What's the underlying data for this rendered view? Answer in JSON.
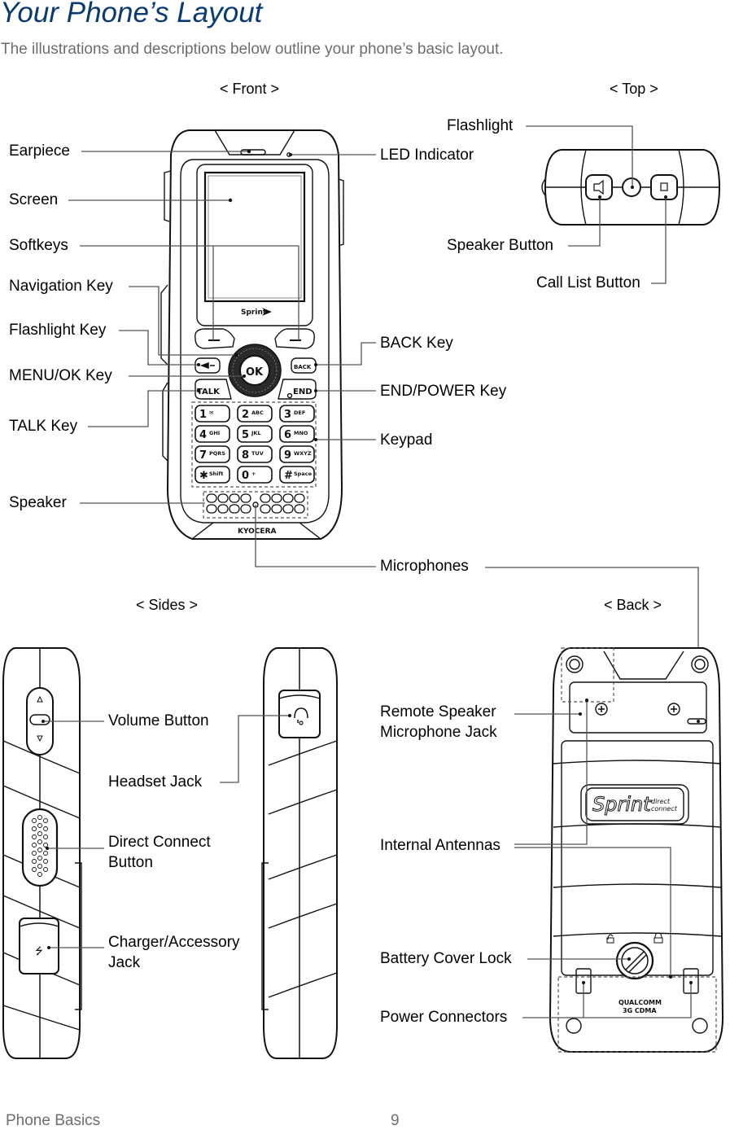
{
  "page": {
    "title": "Your Phone’s Layout",
    "intro": "The illustrations and descriptions below outline your phone’s basic layout.",
    "accent_color": "#0b3a72"
  },
  "views": {
    "front": "< Front >",
    "top": "< Top >",
    "sides": "< Sides >",
    "back": "< Back >"
  },
  "front_labels": {
    "earpiece": "Earpiece",
    "screen": "Screen",
    "softkeys": "Softkeys",
    "navigation_key": "Navigation Key",
    "flashlight_key": "Flashlight Key",
    "menu_ok_key": "MENU/OK Key",
    "talk_key": "TALK Key",
    "speaker": "Speaker",
    "led_indicator": "LED Indicator",
    "back_key": "BACK Key",
    "end_power_key": "END/POWER Key",
    "keypad": "Keypad",
    "microphones": "Microphones"
  },
  "top_labels": {
    "flashlight": "Flashlight",
    "speaker_button": "Speaker Button",
    "call_list_button": "Call List Button"
  },
  "side_labels": {
    "volume_button": "Volume Button",
    "headset_jack": "Headset Jack",
    "direct_connect_button_line1": "Direct Connect",
    "direct_connect_button_line2": "Button",
    "charger_jack_line1": "Charger/Accessory",
    "charger_jack_line2": "Jack"
  },
  "back_labels": {
    "remote_speaker_line1": "Remote Speaker",
    "remote_speaker_line2": "Microphone Jack",
    "internal_antennas": "Internal Antennas",
    "battery_cover_lock": "Battery Cover Lock",
    "power_connectors": "Power Connectors"
  },
  "phone_markings": {
    "brand_front": "Sprint",
    "maker": "KYOCERA",
    "ok": "OK",
    "talk": "TALK",
    "end": "END",
    "back": "BACK",
    "keys": [
      {
        "num": "1",
        "sub": "✉"
      },
      {
        "num": "2",
        "sub": "ABC"
      },
      {
        "num": "3",
        "sub": "DEF"
      },
      {
        "num": "4",
        "sub": "GHI"
      },
      {
        "num": "5",
        "sub": "JKL"
      },
      {
        "num": "6",
        "sub": "MNO"
      },
      {
        "num": "7",
        "sub": "PQRS"
      },
      {
        "num": "8",
        "sub": "TUV"
      },
      {
        "num": "9",
        "sub": "WXYZ"
      },
      {
        "num": "✱",
        "sub": "Shift"
      },
      {
        "num": "0",
        "sub": "+"
      },
      {
        "num": "#",
        "sub": "Space"
      }
    ],
    "back_logo": "Sprint",
    "back_logo_sub1": "direct",
    "back_logo_sub2": "connect",
    "chip_line1": "QUALCOMM",
    "chip_line2": "3G CDMA"
  },
  "footer": {
    "section": "Phone Basics",
    "page_number": "9"
  }
}
